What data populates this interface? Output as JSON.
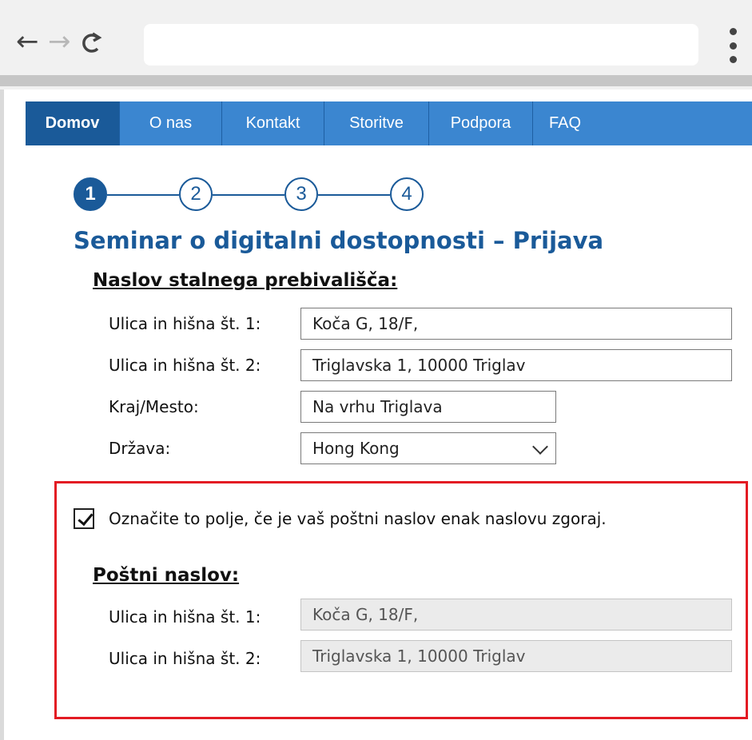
{
  "browser": {
    "back_icon": "←",
    "forward_icon": "→",
    "reload_icon": "C",
    "address": ""
  },
  "nav": {
    "tabs": [
      {
        "label": "Domov",
        "active": true
      },
      {
        "label": "O nas"
      },
      {
        "label": "Kontakt"
      },
      {
        "label": "Storitve"
      },
      {
        "label": "Podpora"
      },
      {
        "label": "FAQ"
      }
    ]
  },
  "steps": {
    "items": [
      "1",
      "2",
      "3",
      "4"
    ],
    "current": 1
  },
  "page": {
    "title": "Seminar o digitalni dostopnosti – Prijava"
  },
  "permanent_address": {
    "heading": "Naslov stalnega prebivališča:",
    "street1_label": "Ulica in hišna št. 1:",
    "street1_value": "Koča G, 18/F,",
    "street2_label": "Ulica in hišna št. 2:",
    "street2_value": "Triglavska 1, 10000 Triglav",
    "city_label": "Kraj/Mesto:",
    "city_value": "Na vrhu Triglava",
    "country_label": "Država:",
    "country_value": "Hong Kong"
  },
  "same_address": {
    "checked": true,
    "label": "Označite to polje, če je vaš poštni naslov enak naslovu zgoraj."
  },
  "postal_address": {
    "heading": "Poštni naslov:",
    "street1_label": "Ulica in hišna št. 1:",
    "street1_value": "Koča G, 18/F,",
    "street2_label": "Ulica in hišna št. 2:",
    "street2_value": "Triglavska 1, 10000 Triglav"
  },
  "colors": {
    "nav_bg": "#3b86d0",
    "nav_active": "#1a5a99",
    "title": "#1a5a99",
    "highlight_border": "#e31b23"
  }
}
